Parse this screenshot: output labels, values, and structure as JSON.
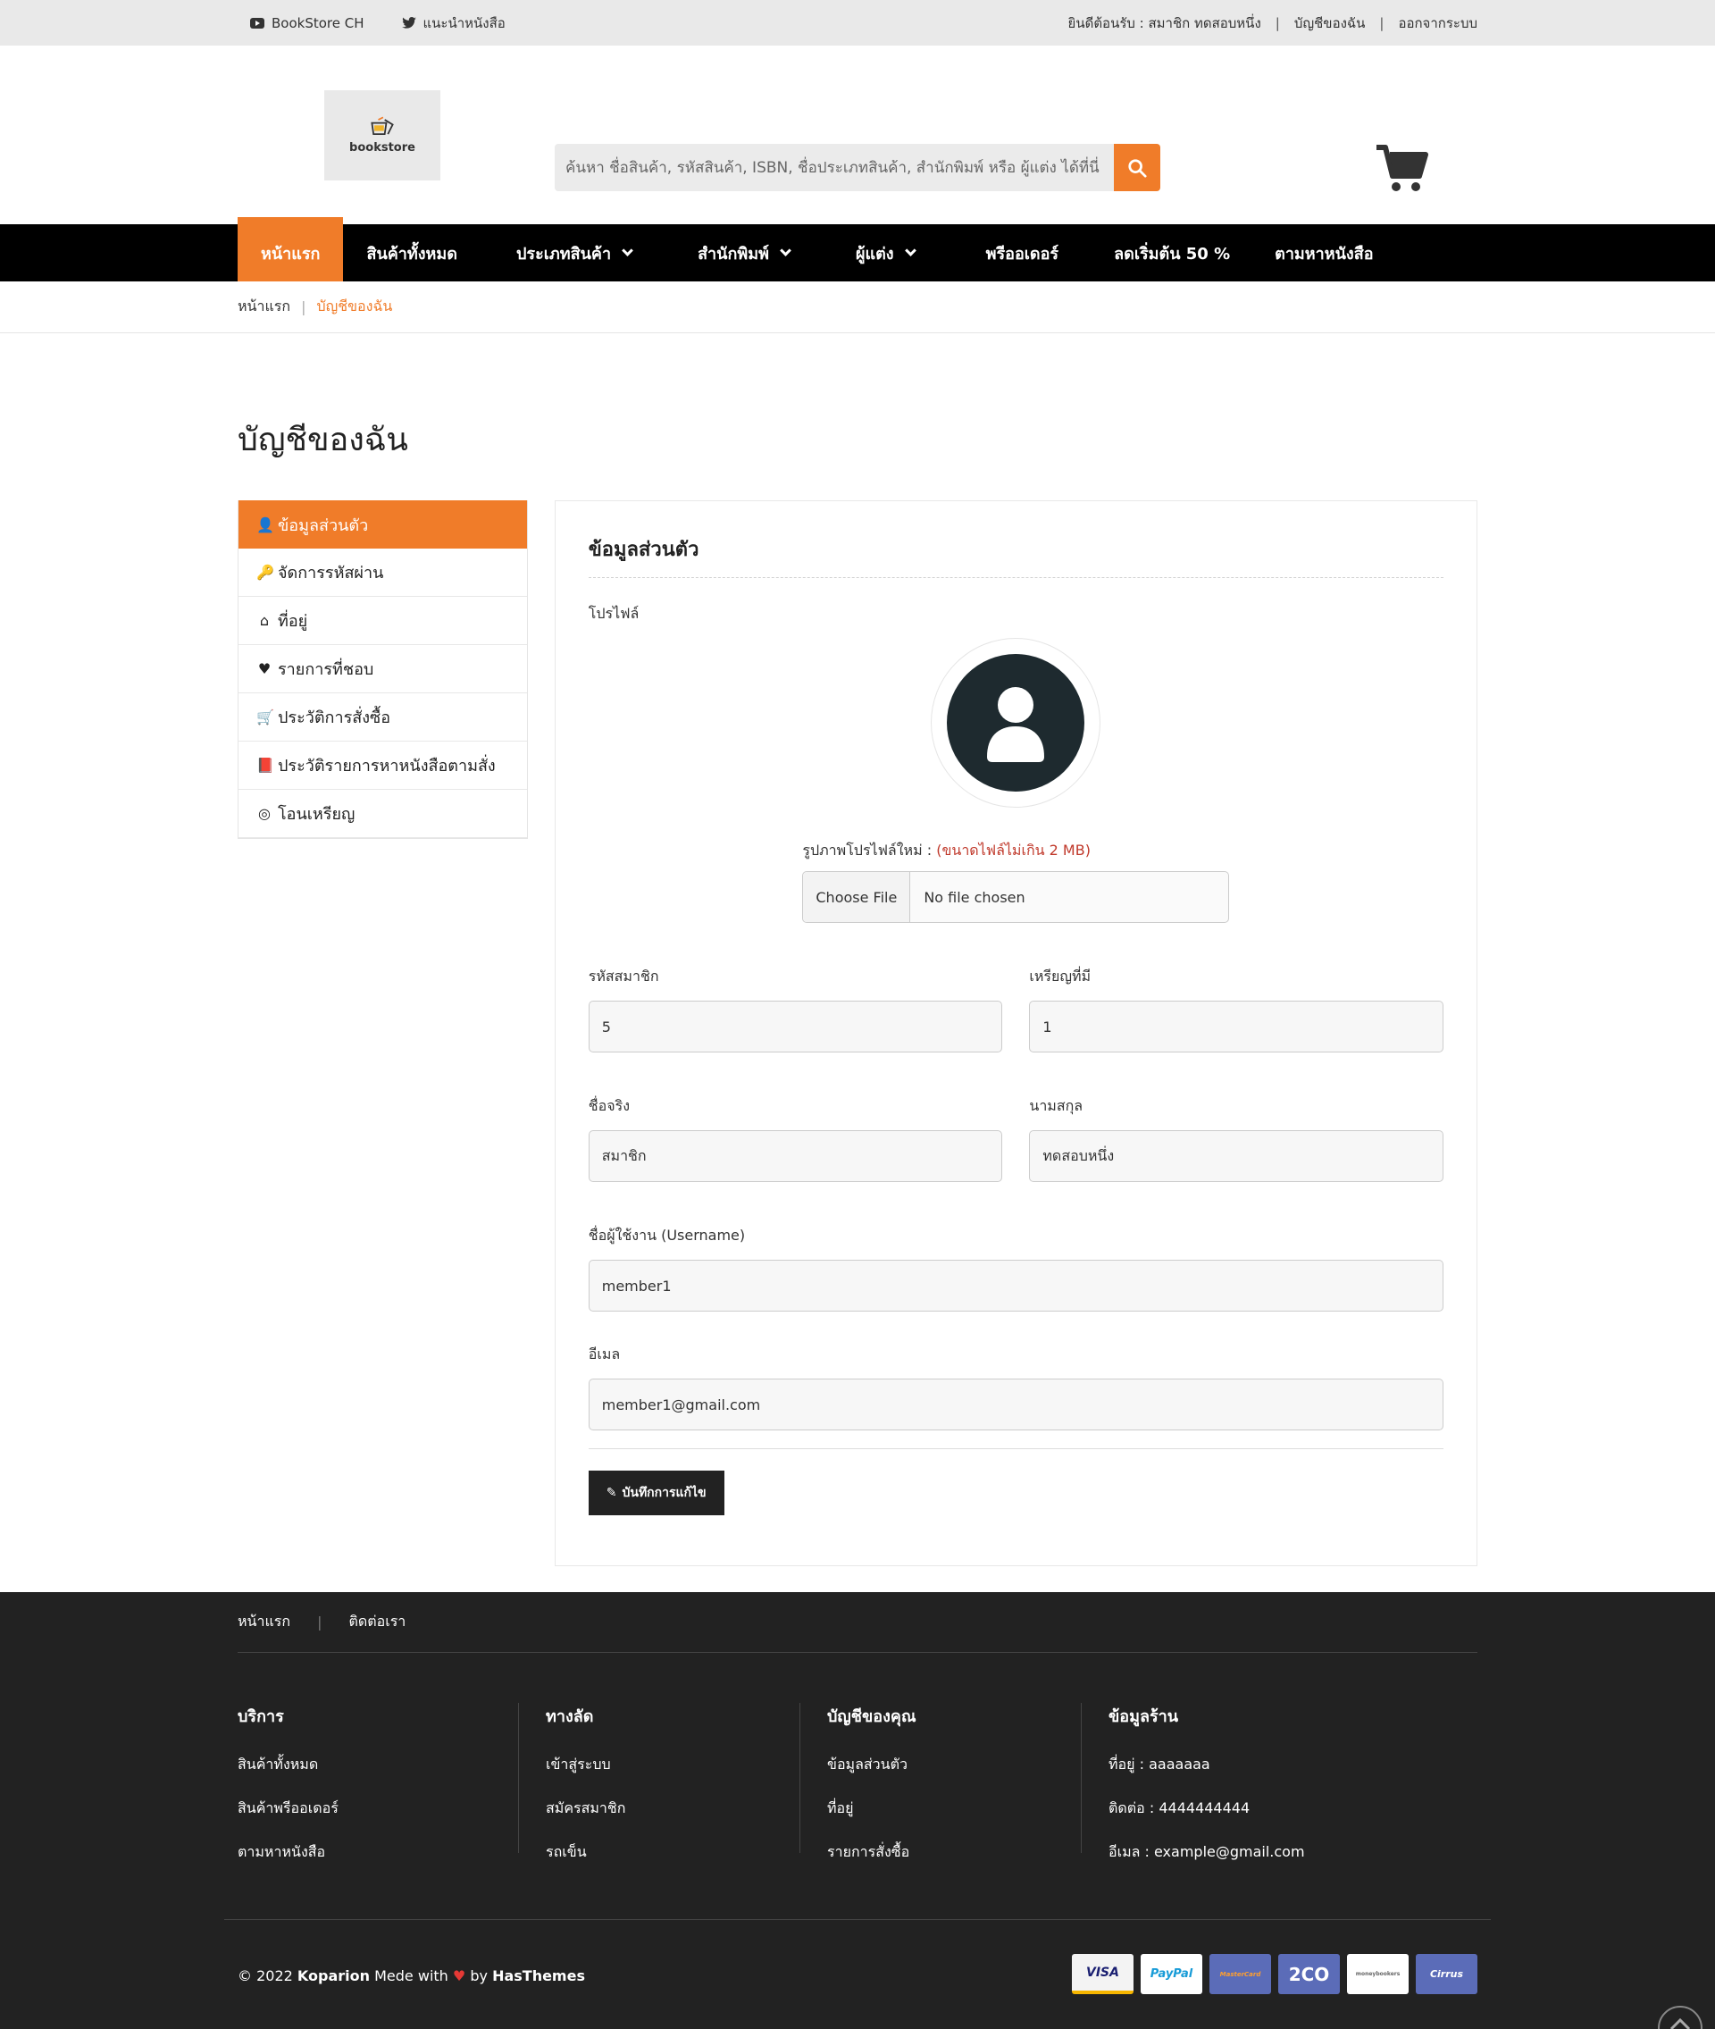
{
  "topbar": {
    "youtube_label": "BookStore CH",
    "twitter_label": "แนะนำหนังสือ",
    "welcome": "ยินดีต้อนรับ : สมาชิก ทดสอบหนึ่ง",
    "my_account": "บัญชีของฉัน",
    "logout": "ออกจากระบบ"
  },
  "header": {
    "logo_text": "bookstore",
    "search_placeholder": "ค้นหา ชื่อสินค้า, รหัสสินค้า, ISBN, ชื่อประเภทสินค้า, สำนักพิมพ์ หรือ ผู้แต่ง ได้ที่นี่"
  },
  "nav": {
    "items": [
      {
        "label": "หน้าแรก"
      },
      {
        "label": "สินค้าทั้งหมด"
      },
      {
        "label": "ประเภทสินค้า"
      },
      {
        "label": "สำนักพิมพ์"
      },
      {
        "label": "ผู้แต่ง"
      },
      {
        "label": "พรีออเดอร์"
      },
      {
        "label": "ลดเริ่มต้น 50 %"
      },
      {
        "label": "ตามหาหนังสือ"
      }
    ]
  },
  "breadcrumb": {
    "home": "หน้าแรก",
    "current": "บัญชีของฉัน"
  },
  "page_title": "บัญชีของฉัน",
  "sidebar": {
    "items": [
      {
        "label": "ข้อมูลส่วนตัว",
        "icon": "user-edit-icon"
      },
      {
        "label": "จัดการรหัสผ่าน",
        "icon": "key-icon"
      },
      {
        "label": "ที่อยู่",
        "icon": "home-icon"
      },
      {
        "label": "รายการที่ชอบ",
        "icon": "heart-icon"
      },
      {
        "label": "ประวัติการสั่งซื้อ",
        "icon": "cart-icon"
      },
      {
        "label": "ประวัติรายการหาหนังสือตามสั่ง",
        "icon": "book-icon"
      },
      {
        "label": "โอนเหรียญ",
        "icon": "coin-icon"
      }
    ]
  },
  "profile": {
    "heading": "ข้อมูลส่วนตัว",
    "profile_label": "โปรไฟล์",
    "upload_label": "รูปภาพโปรไฟล์ใหม่ :",
    "upload_warn": "(ขนาดไฟล์ไม่เกิน 2 MB)",
    "choose_file": "Choose File",
    "no_file": "No file chosen",
    "member_id_label": "รหัสสมาชิก",
    "member_id": "5",
    "coins_label": "เหรียญที่มี",
    "coins": "1",
    "firstname_label": "ชื่อจริง",
    "firstname": "สมาชิก",
    "lastname_label": "นามสกุล",
    "lastname": "ทดสอบหนึ่ง",
    "username_label": "ชื่อผู้ใช้งาน (Username)",
    "username": "member1",
    "email_label": "อีเมล",
    "email": "member1@gmail.com",
    "save_label": "บันทึกการแก้ไข"
  },
  "footer": {
    "top_links": [
      "หน้าแรก",
      "ติดต่อเรา"
    ],
    "service": {
      "title": "บริการ",
      "links": [
        "สินค้าทั้งหมด",
        "สินค้าพรีออเดอร์",
        "ตามหาหนังสือ"
      ]
    },
    "shortcut": {
      "title": "ทางลัด",
      "links": [
        "เข้าสู่ระบบ",
        "สมัครสมาชิก",
        "รถเข็น"
      ]
    },
    "account": {
      "title": "บัญชีของคุณ",
      "links": [
        "ข้อมูลส่วนตัว",
        "ที่อยู่",
        "รายการสั่งซื้อ"
      ]
    },
    "shop": {
      "title": "ข้อมูลร้าน",
      "address": "ที่อยู่ : aaaaaaa",
      "contact": "ติดต่อ : 4444444444",
      "email": "อีเมล : example@gmail.com"
    },
    "copyright_pre": "© 2022",
    "brand": "Koparion",
    "made_with": "Mede with",
    "by": "by",
    "author": "HasThemes",
    "payments": [
      "VISA",
      "PayPal",
      "MasterCard",
      "2CO",
      "moneybookers",
      "Cirrus"
    ]
  },
  "colors": {
    "accent": "#f07c29",
    "nav_bg": "#000000",
    "footer_bg": "#222222"
  }
}
